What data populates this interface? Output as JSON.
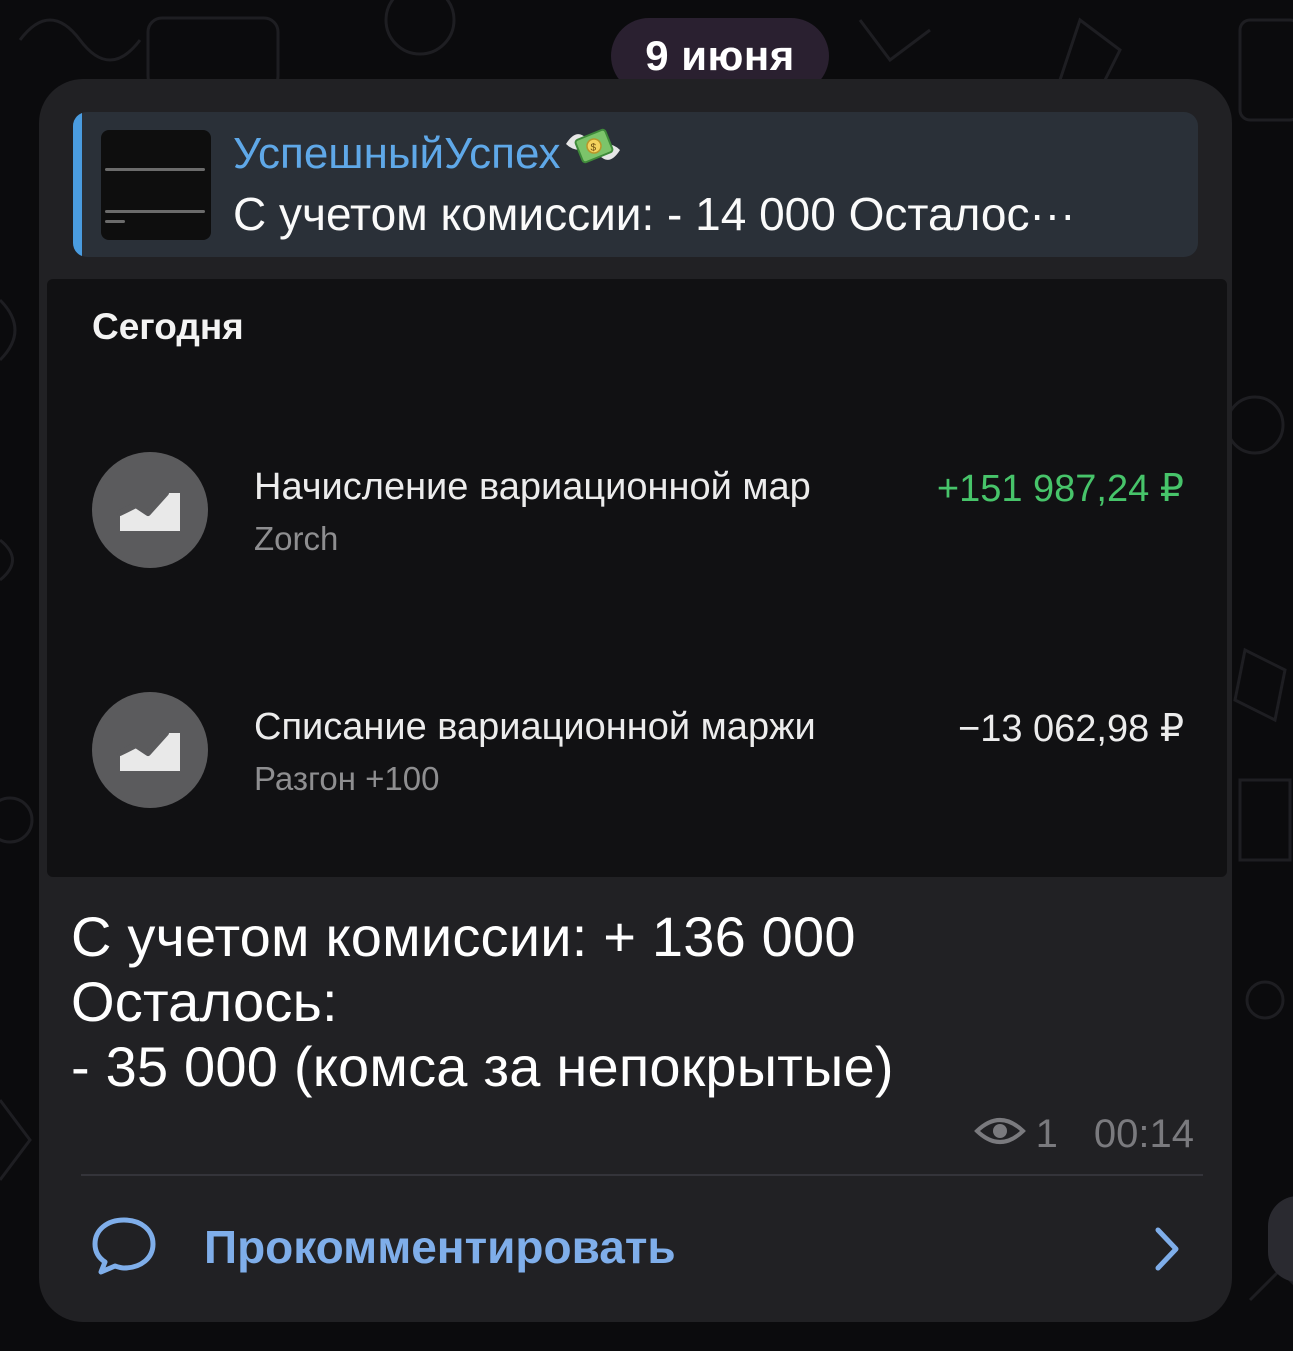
{
  "date_badge": "9 июня",
  "reply": {
    "title": "УспешныйУспех",
    "title_emoji": "money-with-wings-icon",
    "text": "С учетом комиссии: - 14 000 Осталос···"
  },
  "screenshot": {
    "section_label": "Сегодня",
    "transactions": [
      {
        "title": "Начисление вариационной мар",
        "subtitle": "Zorch",
        "amount": "+151 987,24 ₽",
        "icon": "trend-chart-icon"
      },
      {
        "title": "Списание вариационной маржи",
        "subtitle": "Разгон +100",
        "amount": "−13 062,98 ₽",
        "icon": "trend-chart-icon"
      }
    ]
  },
  "message": {
    "text": "С учетом комиссии: + 136 000\nОсталось:\n- 35 000 (комса за непокрытые)",
    "views": "1",
    "time": "00:14"
  },
  "comment": {
    "label": "Прокомментировать"
  },
  "colors": {
    "accent": "#5fa8e8",
    "positive": "#47c46a",
    "bubble": "#212124"
  }
}
